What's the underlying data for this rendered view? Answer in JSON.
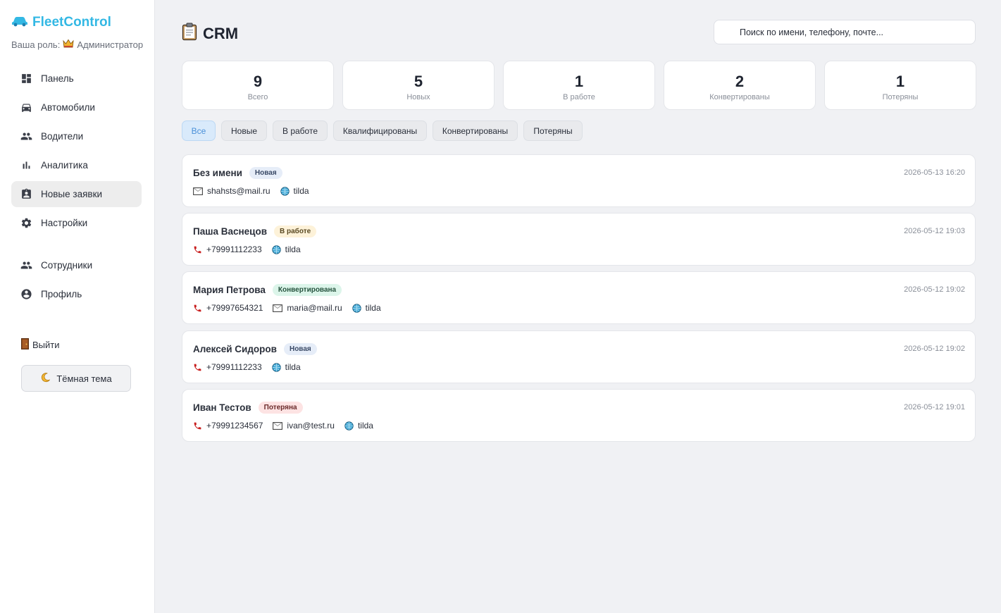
{
  "sidebar": {
    "brand": "FleetControl",
    "role_label": "Ваша роль:",
    "role_value": "Администратор",
    "items": [
      {
        "label": "Панель",
        "icon": "dashboard-icon"
      },
      {
        "label": "Автомобили",
        "icon": "car-icon"
      },
      {
        "label": "Водители",
        "icon": "people-icon"
      },
      {
        "label": "Аналитика",
        "icon": "bar-chart-icon"
      },
      {
        "label": "Новые заявки",
        "icon": "assignment-ind-icon"
      },
      {
        "label": "Настройки",
        "icon": "gear-icon"
      },
      {
        "label": "Сотрудники",
        "icon": "people-icon"
      },
      {
        "label": "Профиль",
        "icon": "account-circle-icon"
      }
    ],
    "active_item": "Новые заявки",
    "logout": "Выйти",
    "theme_toggle": "Тёмная тема"
  },
  "header": {
    "title": "CRM",
    "search_placeholder": "Поиск по имени, телефону, почте..."
  },
  "stats": [
    {
      "value": "9",
      "label": "Всего"
    },
    {
      "value": "5",
      "label": "Новых"
    },
    {
      "value": "1",
      "label": "В работе"
    },
    {
      "value": "2",
      "label": "Конвертированы"
    },
    {
      "value": "1",
      "label": "Потеряны"
    }
  ],
  "filters": [
    "Все",
    "Новые",
    "В работе",
    "Квалифицированы",
    "Конвертированы",
    "Потеряны"
  ],
  "active_filter": "Все",
  "leads": [
    {
      "name": "Без имени",
      "status": "Новая",
      "date": "2026-05-13 16:20",
      "phone": "",
      "email": "shahsts@mail.ru",
      "source": "tilda"
    },
    {
      "name": "Паша Васнецов",
      "status": "В работе",
      "date": "2026-05-12 19:03",
      "phone": "+79991112233",
      "email": "",
      "source": "tilda"
    },
    {
      "name": "Мария Петрова",
      "status": "Конвертирована",
      "date": "2026-05-12 19:02",
      "phone": "+79997654321",
      "email": "maria@mail.ru",
      "source": "tilda"
    },
    {
      "name": "Алексей Сидоров",
      "status": "Новая",
      "date": "2026-05-12 19:02",
      "phone": "+79991112233",
      "email": "",
      "source": "tilda"
    },
    {
      "name": "Иван Тестов",
      "status": "Потеряна",
      "date": "2026-05-12 19:01",
      "phone": "+79991234567",
      "email": "ivan@test.ru",
      "source": "tilda"
    }
  ],
  "colors": {
    "brand": "#33b8e4",
    "active_filter_bg": "#d9eafb",
    "active_filter_text": "#4a90d9",
    "badge_new": "#e6edf8",
    "badge_work": "#fdf2d9",
    "badge_converted": "#dcf5ea",
    "badge_lost": "#fde3e3"
  }
}
